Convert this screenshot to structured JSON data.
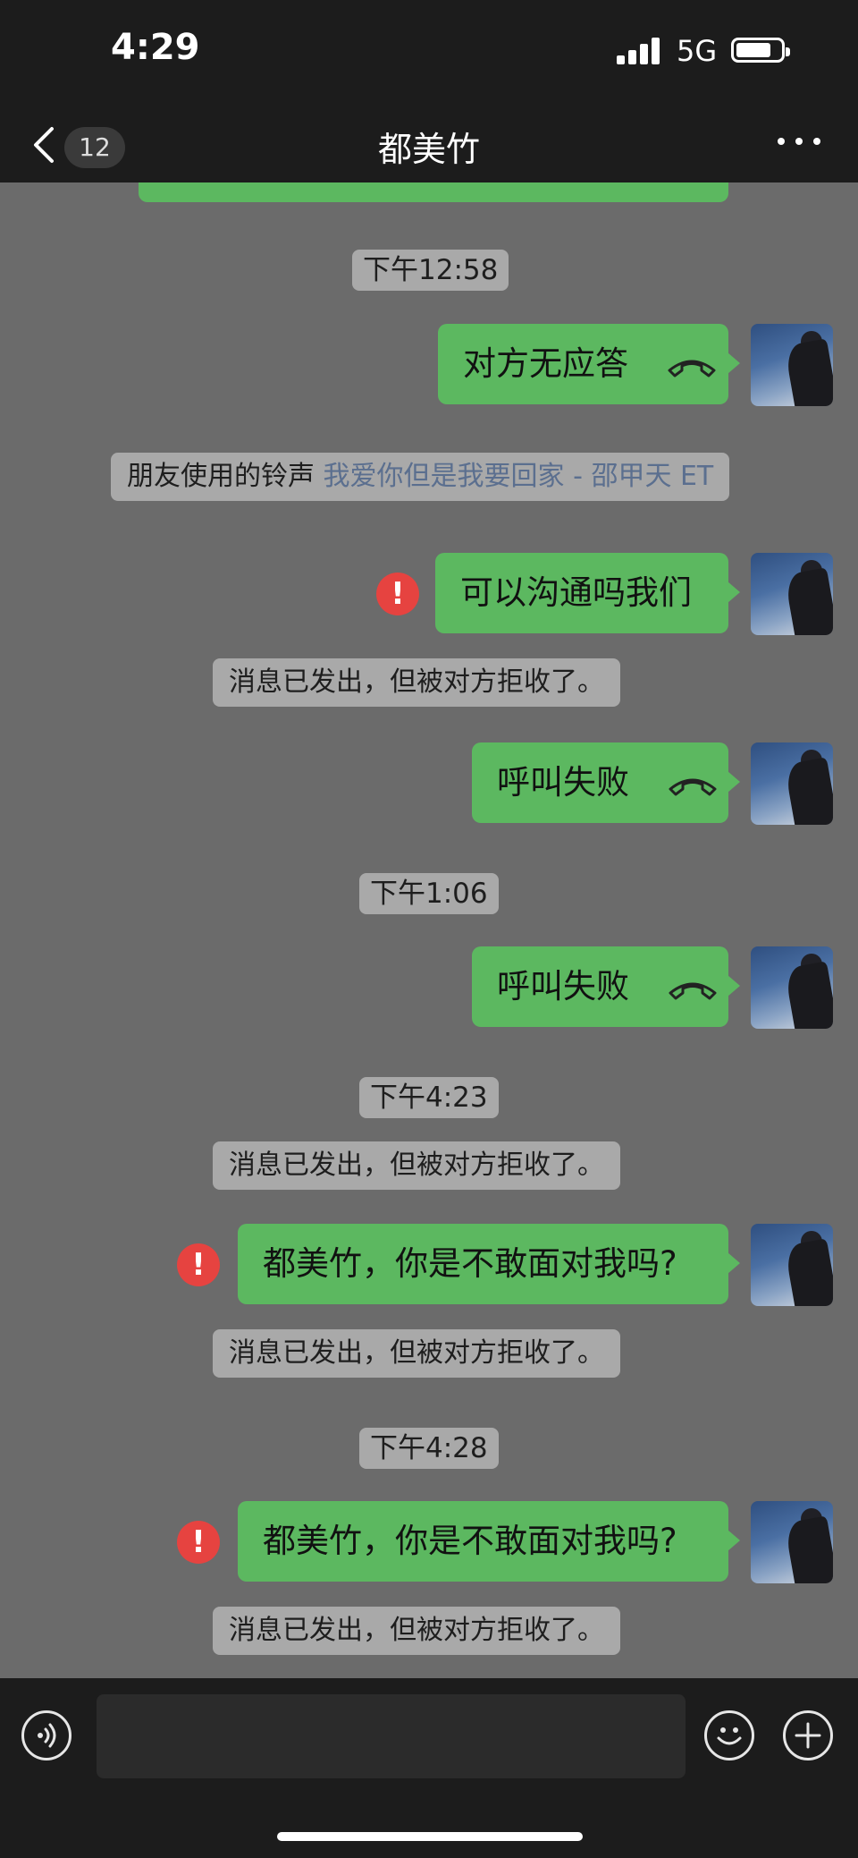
{
  "status_bar": {
    "time": "4:29",
    "network": "5G"
  },
  "header": {
    "unread_count": "12",
    "title": "都美竹"
  },
  "messages": {
    "ts1": "下午12:58",
    "m1": "对方无应答",
    "ringtone_label": "朋友使用的铃声",
    "ringtone_song": "我爱你但是我要回家 - 邵甲天 ET",
    "m2": "可以沟通吗我们",
    "reject1": "消息已发出，但被对方拒收了。",
    "m3": "呼叫失败",
    "ts2": "下午1:06",
    "m4": "呼叫失败",
    "ts3": "下午4:23",
    "reject2": "消息已发出，但被对方拒收了。",
    "m5": "都美竹，你是不敢面对我吗?",
    "reject3": "消息已发出，但被对方拒收了。",
    "ts4": "下午4:28",
    "m6": "都美竹，你是不敢面对我吗?",
    "reject4": "消息已发出，但被对方拒收了。"
  },
  "icons": {
    "failed": "!",
    "back": "chevron-left-icon",
    "more": "more-icon",
    "call": "phone-hangup-icon",
    "voice": "voice-icon",
    "emoji": "emoji-icon",
    "plus": "plus-icon"
  },
  "colors": {
    "bubble": "#5cb860",
    "background": "#6b6b6b",
    "bar": "#1c1c1c",
    "error": "#e64340"
  }
}
